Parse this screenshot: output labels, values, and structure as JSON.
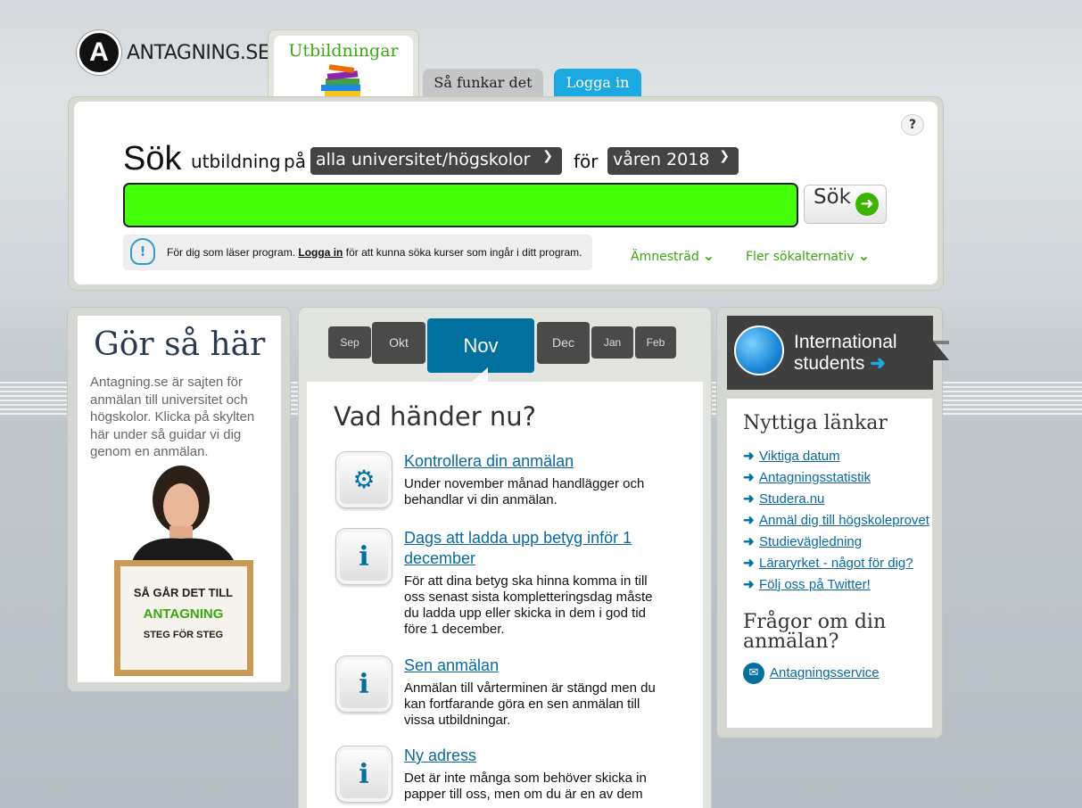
{
  "logo": {
    "mark": "A",
    "text": "ANTAGNING.SE"
  },
  "tabs": {
    "utbildningar": "Utbildningar",
    "sa_funkar_det": "Så funkar det",
    "logga_in": "Logga in"
  },
  "search": {
    "heading": "Sök",
    "word_utbildning": "utbildning",
    "word_pa": "på",
    "university_select": "alla universitet/högskolor",
    "word_for": "för",
    "term_select": "våren 2018",
    "input_value": "",
    "button_label": "Sök",
    "help_icon": "question-icon",
    "info_before": "För dig som läser program.",
    "info_link": "Logga in",
    "info_after": "för att kunna söka kurser som ingår i ditt program.",
    "amnestrad": "Ämnesträd",
    "fler_alternativ": "Fler sökalternativ",
    "accent_color": "#46ff0b"
  },
  "left": {
    "title": "Gör så här",
    "text": "Antagning.se är sajten för anmälan till universitet och högskolor. Klicka på skylten här under så guidar vi dig genom en anmälan.",
    "sign_line1": "SÅ GÅR DET TILL",
    "sign_line2": "ANTAGNING",
    "sign_line3": "STEG FÖR STEG"
  },
  "months": {
    "sep": "Sep",
    "okt": "Okt",
    "nov": "Nov",
    "dec": "Dec",
    "jan": "Jan",
    "feb": "Feb",
    "selected": "Nov"
  },
  "events": {
    "title": "Vad händer nu?",
    "items": [
      {
        "icon": "gears-icon",
        "title": "Kontrollera din anmälan",
        "desc": "Under november månad handlägger och behandlar vi din anmälan."
      },
      {
        "icon": "info-icon",
        "title": "Dags att ladda upp betyg inför 1 december",
        "desc": "För att dina betyg ska hinna komma in till oss senast sista kompletteringsdag måste du ladda upp eller skicka in dem i god tid före 1 december."
      },
      {
        "icon": "info-icon",
        "title": "Sen anmälan",
        "desc": "Anmälan till vårterminen är stängd men du kan fortfarande göra en sen anmälan till vissa utbildningar."
      },
      {
        "icon": "info-icon",
        "title": "Ny adress",
        "desc": "Det är inte många som behöver skicka in papper till oss, men om du är en av dem"
      }
    ]
  },
  "right": {
    "intl_line1": "International",
    "intl_line2": "students",
    "useful_title": "Nyttiga länkar",
    "links": [
      "Viktiga datum",
      "Antagningsstatistik",
      "Studera.nu",
      "Anmäl dig till högskoleprovet",
      "Studievägledning",
      "Läraryrket - något för dig?",
      "Följ oss på Twitter!"
    ],
    "questions_title": "Frågor om din anmälan?",
    "service_link": "Antagningsservice"
  },
  "colors": {
    "brand_blue": "#00709f",
    "green": "#3aa810",
    "tab_blue": "#1ba9e1"
  }
}
